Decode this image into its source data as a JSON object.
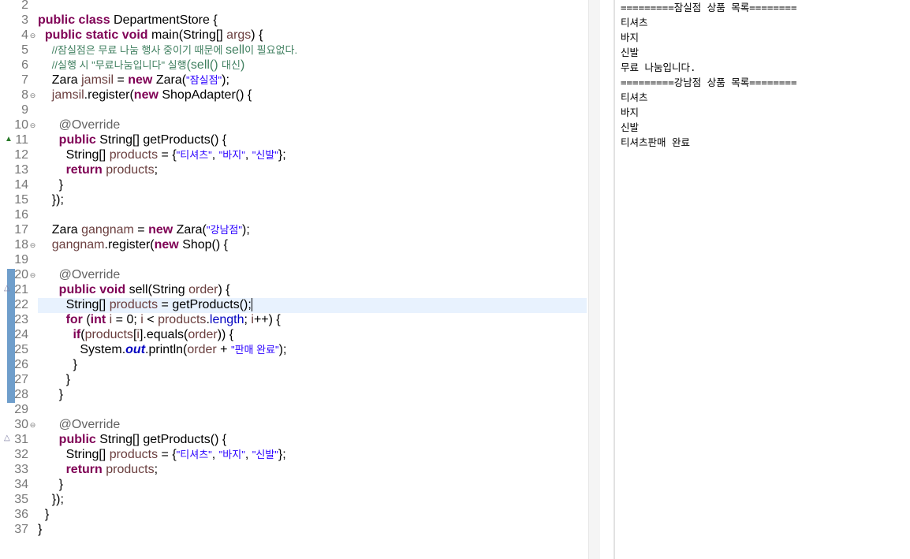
{
  "editor": {
    "lines": [
      {
        "num": "2",
        "tokens": []
      },
      {
        "num": "3",
        "tokens": [
          {
            "t": "public class ",
            "c": "kw"
          },
          {
            "t": "DepartmentStore {"
          }
        ]
      },
      {
        "num": "4",
        "tokens": [
          {
            "t": "  "
          },
          {
            "t": "public static void ",
            "c": "kw"
          },
          {
            "t": "main(String[] "
          },
          {
            "t": "args",
            "c": "var"
          },
          {
            "t": ") {"
          }
        ]
      },
      {
        "num": "5",
        "tokens": [
          {
            "t": "    "
          },
          {
            "t": "//잠실점은 무료 나눔 행사 중이기 때문에 ",
            "c": "cm"
          },
          {
            "t": "sell",
            "c": "cm-big"
          },
          {
            "t": "이 필요없다.",
            "c": "cm"
          }
        ]
      },
      {
        "num": "6",
        "tokens": [
          {
            "t": "    "
          },
          {
            "t": "//실행 시 \"무료나눔입니다\" 실행",
            "c": "cm"
          },
          {
            "t": "(sell() ",
            "c": "cm-big"
          },
          {
            "t": "대신",
            "c": "cm"
          },
          {
            "t": ")",
            "c": "cm-big"
          }
        ]
      },
      {
        "num": "7",
        "tokens": [
          {
            "t": "    Zara "
          },
          {
            "t": "jamsil",
            "c": "var"
          },
          {
            "t": " = "
          },
          {
            "t": "new ",
            "c": "kw"
          },
          {
            "t": "Zara("
          },
          {
            "t": "\"잠실점\"",
            "c": "str-small"
          },
          {
            "t": ");"
          }
        ]
      },
      {
        "num": "8",
        "tokens": [
          {
            "t": "    "
          },
          {
            "t": "jamsil",
            "c": "var"
          },
          {
            "t": ".register("
          },
          {
            "t": "new ",
            "c": "kw"
          },
          {
            "t": "ShopAdapter() {"
          }
        ]
      },
      {
        "num": "9",
        "tokens": []
      },
      {
        "num": "10",
        "tokens": [
          {
            "t": "      "
          },
          {
            "t": "@Override",
            "c": "ann"
          }
        ]
      },
      {
        "num": "11",
        "tokens": [
          {
            "t": "      "
          },
          {
            "t": "public ",
            "c": "kw"
          },
          {
            "t": "String[] getProducts() {"
          }
        ]
      },
      {
        "num": "12",
        "tokens": [
          {
            "t": "        String[] "
          },
          {
            "t": "products",
            "c": "var"
          },
          {
            "t": " = {"
          },
          {
            "t": "\"티셔츠\"",
            "c": "str-small"
          },
          {
            "t": ", "
          },
          {
            "t": "\"바지\"",
            "c": "str-small"
          },
          {
            "t": ", "
          },
          {
            "t": "\"신발\"",
            "c": "str-small"
          },
          {
            "t": "};"
          }
        ]
      },
      {
        "num": "13",
        "tokens": [
          {
            "t": "        "
          },
          {
            "t": "return ",
            "c": "kw"
          },
          {
            "t": "products",
            "c": "var"
          },
          {
            "t": ";"
          }
        ]
      },
      {
        "num": "14",
        "tokens": [
          {
            "t": "      }"
          }
        ]
      },
      {
        "num": "15",
        "tokens": [
          {
            "t": "    });"
          }
        ]
      },
      {
        "num": "16",
        "tokens": []
      },
      {
        "num": "17",
        "tokens": [
          {
            "t": "    Zara "
          },
          {
            "t": "gangnam",
            "c": "var"
          },
          {
            "t": " = "
          },
          {
            "t": "new ",
            "c": "kw"
          },
          {
            "t": "Zara("
          },
          {
            "t": "\"강남점\"",
            "c": "str-small"
          },
          {
            "t": ");"
          }
        ]
      },
      {
        "num": "18",
        "tokens": [
          {
            "t": "    "
          },
          {
            "t": "gangnam",
            "c": "var"
          },
          {
            "t": ".register("
          },
          {
            "t": "new ",
            "c": "kw"
          },
          {
            "t": "Shop() {"
          }
        ]
      },
      {
        "num": "19",
        "tokens": []
      },
      {
        "num": "20",
        "tokens": [
          {
            "t": "      "
          },
          {
            "t": "@Override",
            "c": "ann"
          }
        ]
      },
      {
        "num": "21",
        "tokens": [
          {
            "t": "      "
          },
          {
            "t": "public void ",
            "c": "kw"
          },
          {
            "t": "sell(String "
          },
          {
            "t": "order",
            "c": "var"
          },
          {
            "t": ") {"
          }
        ]
      },
      {
        "num": "22",
        "tokens": [
          {
            "t": "        String[] "
          },
          {
            "t": "products",
            "c": "var"
          },
          {
            "t": " = getProducts();"
          }
        ]
      },
      {
        "num": "23",
        "tokens": [
          {
            "t": "        "
          },
          {
            "t": "for ",
            "c": "kw"
          },
          {
            "t": "("
          },
          {
            "t": "int ",
            "c": "kw"
          },
          {
            "t": "i",
            "c": "var"
          },
          {
            "t": " = 0; "
          },
          {
            "t": "i",
            "c": "var"
          },
          {
            "t": " < "
          },
          {
            "t": "products",
            "c": "var"
          },
          {
            "t": "."
          },
          {
            "t": "length",
            "c": "fld"
          },
          {
            "t": "; "
          },
          {
            "t": "i",
            "c": "var"
          },
          {
            "t": "++) {"
          }
        ]
      },
      {
        "num": "24",
        "tokens": [
          {
            "t": "          "
          },
          {
            "t": "if",
            "c": "kw"
          },
          {
            "t": "("
          },
          {
            "t": "products",
            "c": "var"
          },
          {
            "t": "["
          },
          {
            "t": "i",
            "c": "var"
          },
          {
            "t": "].equals("
          },
          {
            "t": "order",
            "c": "var"
          },
          {
            "t": ")) {"
          }
        ]
      },
      {
        "num": "25",
        "tokens": [
          {
            "t": "            System."
          },
          {
            "t": "out",
            "c": "st"
          },
          {
            "t": ".println("
          },
          {
            "t": "order",
            "c": "var"
          },
          {
            "t": " + "
          },
          {
            "t": "\"판매 완료\"",
            "c": "str-small"
          },
          {
            "t": ");"
          }
        ]
      },
      {
        "num": "26",
        "tokens": [
          {
            "t": "          }"
          }
        ]
      },
      {
        "num": "27",
        "tokens": [
          {
            "t": "        }"
          }
        ]
      },
      {
        "num": "28",
        "tokens": [
          {
            "t": "      }"
          }
        ]
      },
      {
        "num": "29",
        "tokens": []
      },
      {
        "num": "30",
        "tokens": [
          {
            "t": "      "
          },
          {
            "t": "@Override",
            "c": "ann"
          }
        ]
      },
      {
        "num": "31",
        "tokens": [
          {
            "t": "      "
          },
          {
            "t": "public ",
            "c": "kw"
          },
          {
            "t": "String[] getProducts() {"
          }
        ]
      },
      {
        "num": "32",
        "tokens": [
          {
            "t": "        String[] "
          },
          {
            "t": "products",
            "c": "var"
          },
          {
            "t": " = {"
          },
          {
            "t": "\"티셔츠\"",
            "c": "str-small"
          },
          {
            "t": ", "
          },
          {
            "t": "\"바지\"",
            "c": "str-small"
          },
          {
            "t": ", "
          },
          {
            "t": "\"신발\"",
            "c": "str-small"
          },
          {
            "t": "};"
          }
        ]
      },
      {
        "num": "33",
        "tokens": [
          {
            "t": "        "
          },
          {
            "t": "return ",
            "c": "kw"
          },
          {
            "t": "products",
            "c": "var"
          },
          {
            "t": ";"
          }
        ]
      },
      {
        "num": "34",
        "tokens": [
          {
            "t": "      }"
          }
        ]
      },
      {
        "num": "35",
        "tokens": [
          {
            "t": "    });"
          }
        ]
      },
      {
        "num": "36",
        "tokens": [
          {
            "t": "  }"
          }
        ]
      },
      {
        "num": "37",
        "tokens": [
          {
            "t": "}"
          }
        ]
      }
    ],
    "fold_lines": [
      "4",
      "8",
      "10",
      "18",
      "20",
      "30"
    ],
    "override_lines": [
      "11"
    ],
    "implement_lines": [
      "21",
      "31"
    ],
    "current_line": "22",
    "caret_after_line": "22"
  },
  "console": {
    "lines": [
      "=========잠실점 상품 목록========",
      "티셔츠",
      "바지",
      "신발",
      "무료 나눔입니다.",
      "=========강남점 상품 목록========",
      "티셔츠",
      "바지",
      "신발",
      "티셔츠판매 완료"
    ]
  },
  "colors": {
    "keyword": "#7f0055",
    "comment": "#3f7f5f",
    "string": "#2a00ff",
    "annotation": "#646464",
    "variable": "#6a3e3e",
    "field": "#0000c0",
    "current_line_bg": "#e8f2fe",
    "change_marker": "#6f9ecb"
  }
}
